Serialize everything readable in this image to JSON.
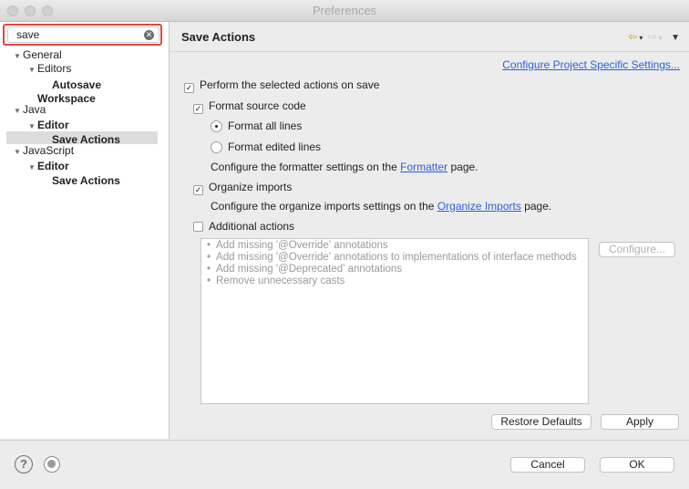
{
  "window": {
    "title": "Preferences"
  },
  "search": {
    "value": "save"
  },
  "tree": {
    "general": "General",
    "editors": "Editors",
    "autosave": "Autosave",
    "workspace": "Workspace",
    "java": "Java",
    "java_editor": "Editor",
    "java_save_actions": "Save Actions",
    "javascript": "JavaScript",
    "js_editor": "Editor",
    "js_save_actions": "Save Actions"
  },
  "page": {
    "title": "Save Actions",
    "configure_link": "Configure Project Specific Settings...",
    "perform_actions": "Perform the selected actions on save",
    "format_source": "Format source code",
    "format_all": "Format all lines",
    "format_edited": "Format edited lines",
    "formatter_text_pre": "Configure the formatter settings on the ",
    "formatter_link": "Formatter",
    "formatter_text_post": " page.",
    "organize_imports": "Organize imports",
    "organize_text_pre": "Configure the organize imports settings on the ",
    "organize_link": "Organize Imports",
    "organize_text_post": " page.",
    "additional_actions": "Additional actions",
    "additional_list": [
      "Add missing '@Override' annotations",
      "Add missing '@Override' annotations to implementations of interface methods",
      "Add missing '@Deprecated' annotations",
      "Remove unnecessary casts"
    ],
    "configure_button": "Configure...",
    "restore_defaults": "Restore Defaults",
    "apply": "Apply"
  },
  "state": {
    "perform_actions": true,
    "format_source": true,
    "format_mode": "all",
    "organize_imports": true,
    "additional_actions": false
  },
  "footer": {
    "cancel": "Cancel",
    "ok": "OK"
  },
  "icons": {
    "back": "back-arrow-icon",
    "forward": "forward-arrow-icon",
    "menu": "view-menu-icon",
    "help": "help-icon",
    "import_export": "import-export-prefs-icon"
  },
  "colors": {
    "search_highlight": "#e0463d",
    "link": "#2b5fd9",
    "selection": "#dcdcdc"
  }
}
